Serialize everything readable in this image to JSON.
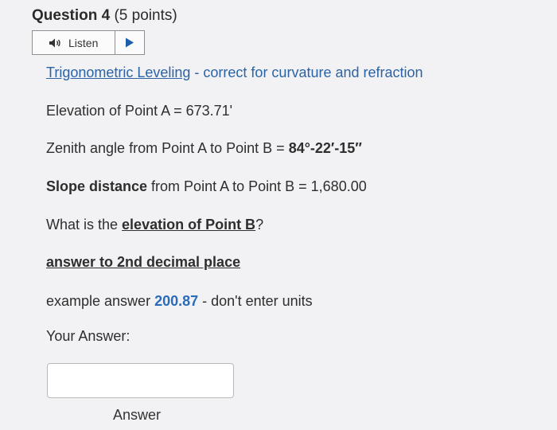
{
  "question": {
    "title": "Question 4",
    "points": "(5 points)"
  },
  "listen": {
    "label": "Listen",
    "speaker_icon": "speaker-icon",
    "play_icon": "play-icon"
  },
  "topic": {
    "link": "Trigonometric Leveling",
    "rest": " - correct for curvature and refraction"
  },
  "elevation_a": "Elevation of Point A = 673.71'",
  "zenith": {
    "label": "Zenith angle from Point A to Point B = ",
    "value": "84°-22′-15″"
  },
  "slope": {
    "label": "Slope distance",
    "rest": " from Point A to Point B  =  1,680.00"
  },
  "question_text": {
    "prefix": "What is the ",
    "emphasis": "elevation of Point B",
    "suffix": "?"
  },
  "instruction": "answer to 2nd decimal place",
  "example": {
    "prefix": "example answer ",
    "value": "200.87",
    "suffix": " - don't enter units"
  },
  "your_answer_label": "Your Answer:",
  "answer": {
    "value": "",
    "label": "Answer"
  }
}
